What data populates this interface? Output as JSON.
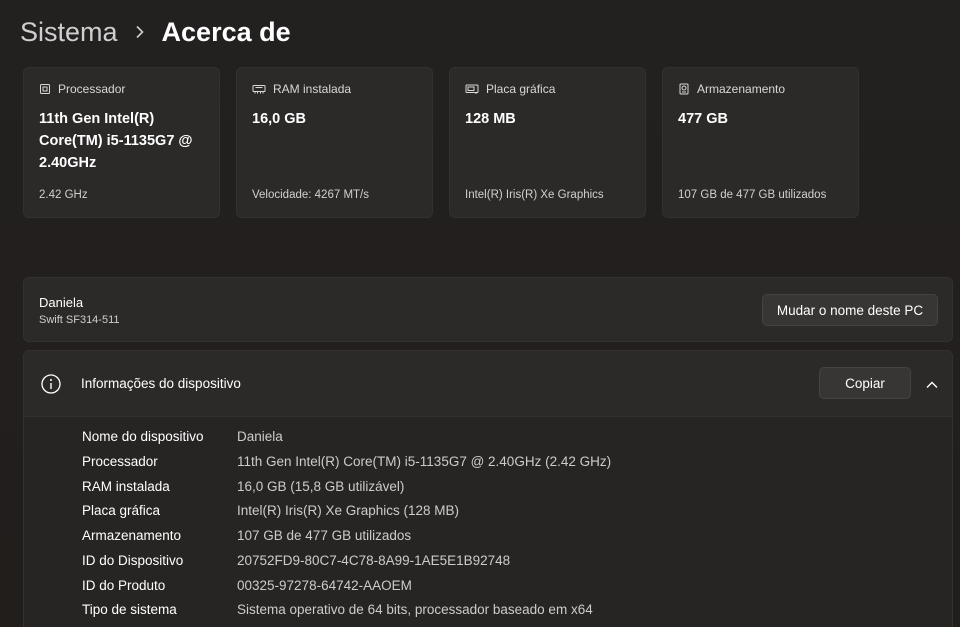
{
  "breadcrumb": {
    "parent": "Sistema",
    "separator_icon": "chevron-right-icon",
    "current": "Acerca de"
  },
  "cards": [
    {
      "icon": "processor-icon",
      "label": "Processador",
      "value": "11th Gen Intel(R) Core(TM) i5-1135G7 @ 2.40GHz",
      "sub": "2.42 GHz"
    },
    {
      "icon": "ram-icon",
      "label": "RAM instalada",
      "value": "16,0 GB",
      "sub": "Velocidade: 4267 MT/s"
    },
    {
      "icon": "gpu-icon",
      "label": "Placa gráfica",
      "value": "128 MB",
      "sub": "Intel(R) Iris(R) Xe Graphics"
    },
    {
      "icon": "storage-icon",
      "label": "Armazenamento",
      "value": "477 GB",
      "sub": "107 GB de 477 GB utilizados"
    }
  ],
  "pc": {
    "name": "Daniela",
    "model": "Swift SF314-511",
    "rename_label": "Mudar o nome deste PC"
  },
  "device_info": {
    "icon": "info-icon",
    "title": "Informações do dispositivo",
    "copy_label": "Copiar",
    "collapse_icon": "chevron-up-icon",
    "rows": [
      {
        "label": "Nome do dispositivo",
        "value": "Daniela"
      },
      {
        "label": "Processador",
        "value": "11th Gen Intel(R) Core(TM) i5-1135G7 @ 2.40GHz (2.42 GHz)"
      },
      {
        "label": "RAM instalada",
        "value": "16,0 GB (15,8 GB utilizável)"
      },
      {
        "label": "Placa gráfica",
        "value": "Intel(R) Iris(R) Xe Graphics (128 MB)"
      },
      {
        "label": "Armazenamento",
        "value": "107 GB de 477 GB utilizados"
      },
      {
        "label": "ID do Dispositivo",
        "value": "20752FD9-80C7-4C78-8A99-1AE5E1B92748"
      },
      {
        "label": "ID do Produto",
        "value": "00325-97278-64742-AAOEM"
      },
      {
        "label": "Tipo de sistema",
        "value": "Sistema operativo de 64 bits, processador baseado em x64"
      }
    ]
  }
}
